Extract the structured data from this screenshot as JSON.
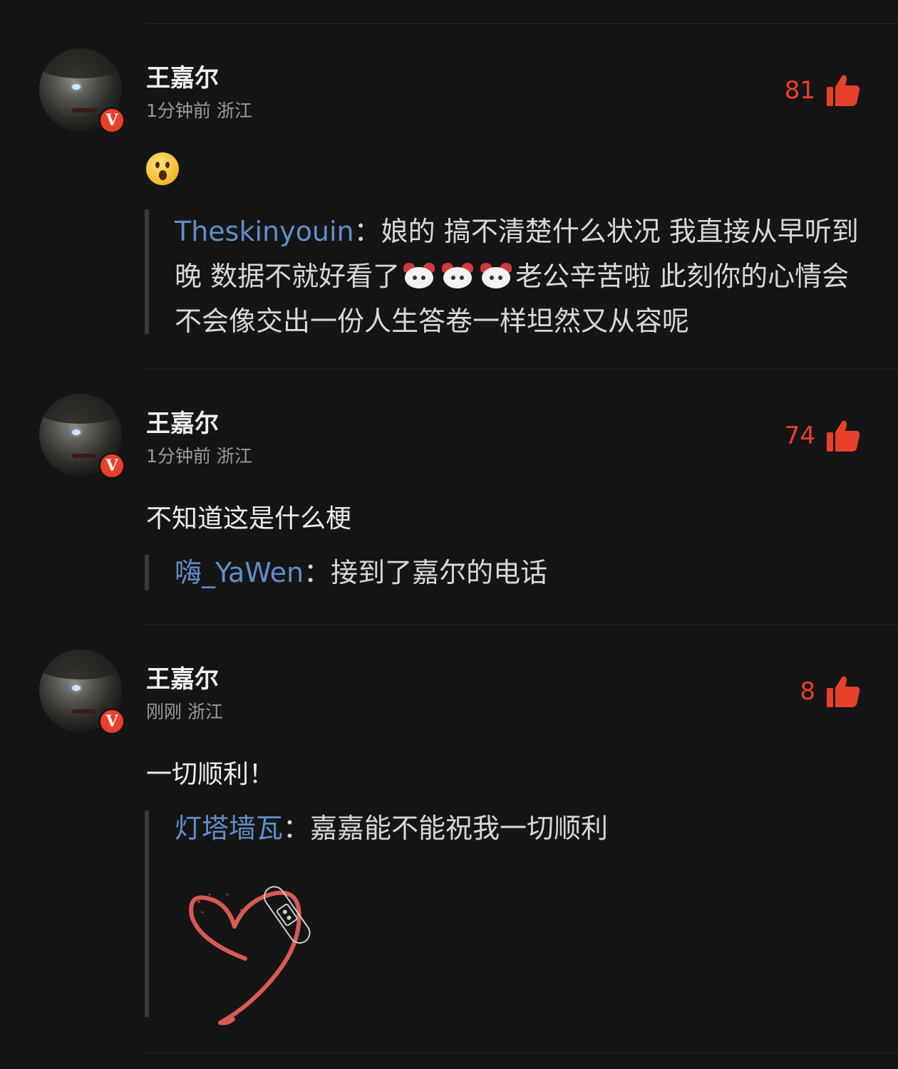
{
  "comments": [
    {
      "username": "王嘉尔",
      "time": "1分钟前",
      "location": "浙江",
      "likes": "81",
      "body_emoji": "wow-emoji",
      "reply": {
        "name": "Theskinyouin",
        "sep": "：",
        "text_a": "娘的 搞不清楚什么状况 我直接从早听到晚 数据不就好看了",
        "text_b": "老公辛苦啦 此刻你的心情会不会像交出一份人生答卷一样坦然又从容呢"
      }
    },
    {
      "username": "王嘉尔",
      "time": "1分钟前",
      "location": "浙江",
      "likes": "74",
      "body": "不知道这是什么梗",
      "reply": {
        "name": "嗨_YaWen",
        "sep": "：",
        "text": "接到了嘉尔的电话"
      }
    },
    {
      "username": "王嘉尔",
      "time": "刚刚",
      "location": "浙江",
      "likes": "8",
      "body": "一切顺利！",
      "reply": {
        "name": "灯塔墙瓦",
        "sep": "：",
        "text": "嘉嘉能不能祝我一切顺利",
        "image": "heart-bandage-image"
      }
    }
  ],
  "badge": "V",
  "colors": {
    "like": "#e8402a",
    "reply_name": "#5f8fc9",
    "background": "#151515"
  }
}
